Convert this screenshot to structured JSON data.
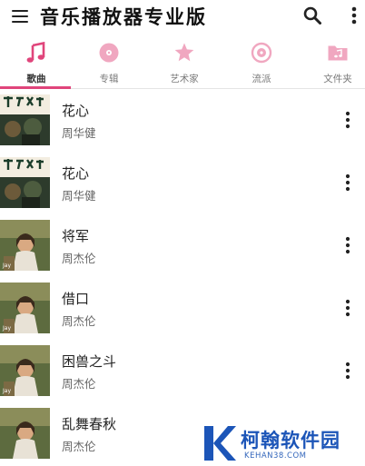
{
  "app_bar": {
    "title": "音乐播放器专业版",
    "menu_icon": "menu-icon",
    "search_icon": "search-icon",
    "overflow_icon": "more-vert-icon"
  },
  "tabs": [
    {
      "label": "歌曲",
      "icon": "music-note-icon",
      "active": true
    },
    {
      "label": "专辑",
      "icon": "album-icon",
      "active": false
    },
    {
      "label": "艺术家",
      "icon": "star-icon",
      "active": false
    },
    {
      "label": "流派",
      "icon": "genre-icon",
      "active": false
    },
    {
      "label": "文件夹",
      "icon": "folder-music-icon",
      "active": false
    }
  ],
  "colors": {
    "accent": "#e0457b",
    "tab_icon_inactive": "#f0a7c0",
    "watermark_blue": "#1c55b8"
  },
  "songs": [
    {
      "title": "花心",
      "artist": "周华健"
    },
    {
      "title": "花心",
      "artist": "周华健"
    },
    {
      "title": "将军",
      "artist": "周杰伦"
    },
    {
      "title": "借口",
      "artist": "周杰伦"
    },
    {
      "title": "困兽之斗",
      "artist": "周杰伦"
    },
    {
      "title": "乱舞春秋",
      "artist": "周杰伦"
    }
  ],
  "watermark": {
    "name": "柯翰软件园",
    "url": "KEHAN38.COM"
  }
}
